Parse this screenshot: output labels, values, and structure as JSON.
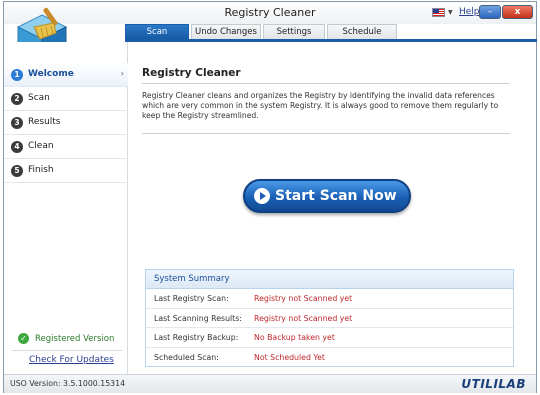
{
  "window": {
    "title": "Registry Cleaner",
    "help_label": "Help",
    "minimize_glyph": "–",
    "close_glyph": "x"
  },
  "tabs": [
    {
      "label": "Scan",
      "active": true
    },
    {
      "label": "Undo Changes",
      "active": false
    },
    {
      "label": "Settings",
      "active": false
    },
    {
      "label": "Schedule",
      "active": false
    }
  ],
  "sidebar": {
    "items": [
      {
        "num": "1",
        "label": "Welcome",
        "active": true
      },
      {
        "num": "2",
        "label": "Scan",
        "active": false
      },
      {
        "num": "3",
        "label": "Results",
        "active": false
      },
      {
        "num": "4",
        "label": "Clean",
        "active": false
      },
      {
        "num": "5",
        "label": "Finish",
        "active": false
      }
    ],
    "registered_label": "Registered Version",
    "updates_label": "Check For Updates"
  },
  "main": {
    "title": "Registry Cleaner",
    "description": "Registry Cleaner cleans and organizes the Registry by identifying the invalid data references which are very common in the system Registry. It is always good to remove them regularly to keep the Registry streamlined.",
    "scan_button_label": "Start Scan Now"
  },
  "summary": {
    "title": "System Summary",
    "rows": [
      {
        "label": "Last Registry Scan:",
        "value": "Registry not Scanned yet"
      },
      {
        "label": "Last Scanning Results:",
        "value": "Registry not Scanned yet"
      },
      {
        "label": "Last Registry Backup:",
        "value": "No Backup taken yet"
      },
      {
        "label": "Scheduled Scan:",
        "value": "Not Scheduled Yet"
      }
    ]
  },
  "status": {
    "version": "USO Version: 3.5.1000.15314",
    "brand": "UTILILAB"
  },
  "colors": {
    "accent": "#1a5ea8",
    "status_red": "#c0272d",
    "registered_green": "#2a7a2a"
  }
}
